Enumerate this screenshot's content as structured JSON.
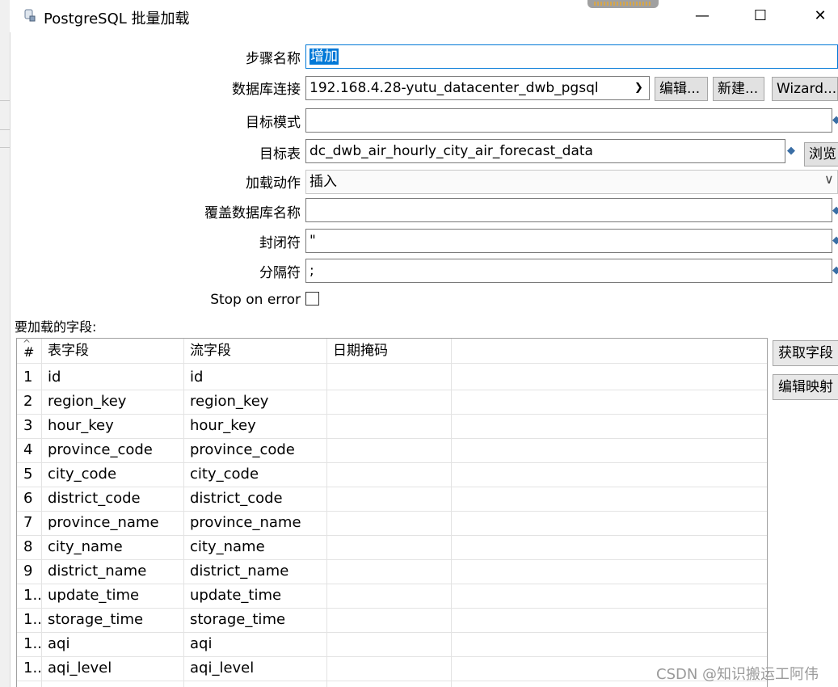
{
  "window": {
    "title": "PostgreSQL 批量加载",
    "minimize": "—",
    "maximize": "☐",
    "close": "✕"
  },
  "form": {
    "step_name_label": "步骤名称",
    "step_name_value": "增加",
    "db_conn_label": "数据库连接",
    "db_conn_value": "192.168.4.28-yutu_datacenter_dwb_pgsql",
    "edit_button": "编辑...",
    "new_button": "新建...",
    "wizard_button": "Wizard...",
    "target_schema_label": "目标模式",
    "target_schema_value": "",
    "target_table_label": "目标表",
    "target_table_value": "dc_dwb_air_hourly_city_air_forecast_data",
    "browse_button": "浏览",
    "load_action_label": "加载动作",
    "load_action_value": "插入",
    "override_db_label": "覆盖数据库名称",
    "override_db_value": "",
    "enclosure_label": "封闭符",
    "enclosure_value": "\"",
    "delimiter_label": "分隔符",
    "delimiter_value": ";",
    "stop_on_error_label": "Stop on error",
    "stop_on_error_checked": false,
    "fields_heading": "要加载的字段:"
  },
  "table": {
    "sort_glyph": "^",
    "headers": [
      "#",
      "表字段",
      "流字段",
      "日期掩码"
    ],
    "rows": [
      {
        "num": "1",
        "table_field": "id",
        "stream_field": "id"
      },
      {
        "num": "2",
        "table_field": "region_key",
        "stream_field": "region_key"
      },
      {
        "num": "3",
        "table_field": "hour_key",
        "stream_field": "hour_key"
      },
      {
        "num": "4",
        "table_field": "province_code",
        "stream_field": "province_code"
      },
      {
        "num": "5",
        "table_field": "city_code",
        "stream_field": "city_code"
      },
      {
        "num": "6",
        "table_field": "district_code",
        "stream_field": "district_code"
      },
      {
        "num": "7",
        "table_field": "province_name",
        "stream_field": "province_name"
      },
      {
        "num": "8",
        "table_field": "city_name",
        "stream_field": "city_name"
      },
      {
        "num": "9",
        "table_field": "district_name",
        "stream_field": "district_name"
      },
      {
        "num": "1..",
        "table_field": "update_time",
        "stream_field": "update_time"
      },
      {
        "num": "1..",
        "table_field": "storage_time",
        "stream_field": "storage_time"
      },
      {
        "num": "1..",
        "table_field": "aqi",
        "stream_field": "aqi"
      },
      {
        "num": "1..",
        "table_field": "aqi_level",
        "stream_field": "aqi_level"
      }
    ]
  },
  "side_buttons": {
    "get_fields": "获取字段",
    "edit_mapping": "编辑映射"
  },
  "watermark": "CSDN @知识搬运工阿伟",
  "colors": {
    "selection": "#0078d7",
    "button_bg": "#e1e1e1",
    "border": "#7a7a7a",
    "variable_icon": "#3a6ea5"
  }
}
